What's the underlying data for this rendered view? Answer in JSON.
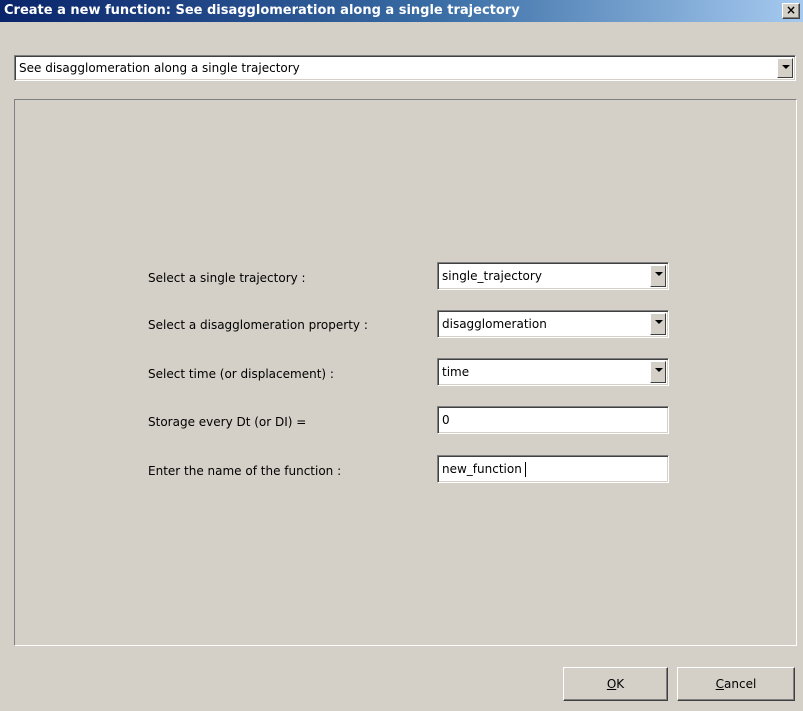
{
  "window": {
    "title": "Create a new function: See disagglomeration along a single trajectory",
    "close_glyph": "×"
  },
  "function_type": {
    "selected": "See disagglomeration along a single trajectory"
  },
  "form": {
    "trajectory": {
      "label": "Select a single trajectory :",
      "value": "single_trajectory"
    },
    "property": {
      "label": "Select a disagglomeration property :",
      "value": "disagglomeration"
    },
    "time": {
      "label": "Select time (or displacement) :",
      "value": "time"
    },
    "storage": {
      "label": "Storage every Dt (or DI) =",
      "value": "0"
    },
    "name": {
      "label": "Enter the name of the function :",
      "value": "new_function"
    }
  },
  "buttons": {
    "ok": {
      "mnemonic": "O",
      "rest": "K"
    },
    "cancel": {
      "mnemonic": "C",
      "rest": "ancel"
    }
  },
  "colors": {
    "titlebar_start": "#0a246a",
    "titlebar_end": "#a6caf0",
    "face": "#d4d0c8"
  }
}
